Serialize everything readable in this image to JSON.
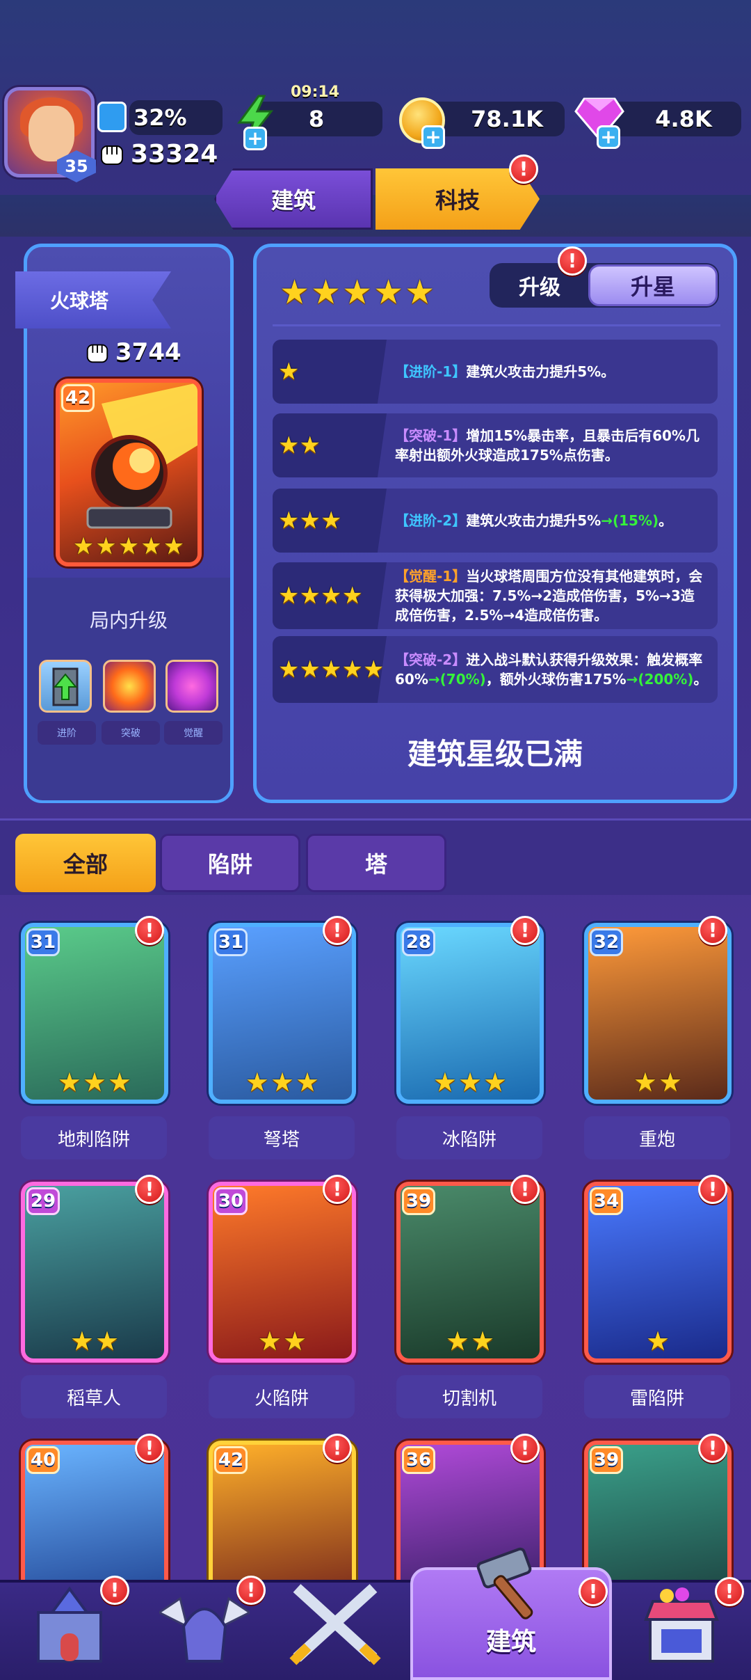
{
  "top": {
    "level": "35",
    "progress_percent": "32%",
    "progress_value": 0.32,
    "power": "33324",
    "timer": "09:14",
    "energy": "8",
    "gold": "78.1K",
    "gems": "4.8K"
  },
  "header": {
    "tab_build": "建筑",
    "tab_tech": "科技"
  },
  "building": {
    "name": "火球塔",
    "power": "3744",
    "level": "42",
    "stars": 5,
    "inner_upgrade_title": "局内升级",
    "skills": [
      {
        "label": "进阶"
      },
      {
        "label": "突破"
      },
      {
        "label": "觉醒"
      }
    ]
  },
  "panel": {
    "toggle_upgrade": "升级",
    "toggle_star": "升星",
    "rows": [
      {
        "stars": 1,
        "tag": "【进阶-1】",
        "tag_color": "blue",
        "text": "建筑火攻击力提升5%。"
      },
      {
        "stars": 2,
        "tag": "【突破-1】",
        "tag_color": "purple",
        "text": "增加15%暴击率，且暴击后有60%几率射出额外火球造成175%点伤害。"
      },
      {
        "stars": 3,
        "tag": "【进阶-2】",
        "tag_color": "blue",
        "text": "建筑火攻击力提升5%",
        "extra": "→(15%)",
        "tail": "。"
      },
      {
        "stars": 4,
        "tag": "【觉醒-1】",
        "tag_color": "orange",
        "text": "当火球塔周围方位没有其他建筑时，会获得极大加强：7.5%→2造成倍伤害，5%→3造成倍伤害，2.5%→4造成倍伤害。"
      },
      {
        "stars": 5,
        "tag": "【突破-2】",
        "tag_color": "purple",
        "text": "进入战斗默认获得升级效果：触发概率60%",
        "extra": "→(70%)",
        "text2": "，额外火球伤害175%",
        "extra2": "→(200%)",
        "tail": "。"
      }
    ],
    "maxed_text": "建筑星级已满"
  },
  "filters": {
    "all": "全部",
    "trap": "陷阱",
    "tower": "塔"
  },
  "cards": [
    {
      "level": "31",
      "name": "地刺陷阱",
      "stars": 3,
      "frame": "blue"
    },
    {
      "level": "31",
      "name": "弩塔",
      "stars": 3,
      "frame": "blue"
    },
    {
      "level": "28",
      "name": "冰陷阱",
      "stars": 3,
      "frame": "blue"
    },
    {
      "level": "32",
      "name": "重炮",
      "stars": 2,
      "frame": "blue"
    },
    {
      "level": "29",
      "name": "稻草人",
      "stars": 2,
      "frame": "pink"
    },
    {
      "level": "30",
      "name": "火陷阱",
      "stars": 2,
      "frame": "pink"
    },
    {
      "level": "39",
      "name": "切割机",
      "stars": 2,
      "frame": "red"
    },
    {
      "level": "34",
      "name": "雷陷阱",
      "stars": 1,
      "frame": "red"
    },
    {
      "level": "40",
      "name": "",
      "stars": 0,
      "frame": "red"
    },
    {
      "level": "42",
      "name": "",
      "stars": 0,
      "frame": "gold"
    },
    {
      "level": "36",
      "name": "",
      "stars": 0,
      "frame": "red"
    },
    {
      "level": "39",
      "name": "",
      "stars": 0,
      "frame": "red"
    }
  ],
  "nav": {
    "active_label": "建筑",
    "items": [
      "castle-icon",
      "helmet-icon",
      "swords-icon",
      "hammer-icon",
      "shop-icon"
    ]
  },
  "alert_symbol": "!",
  "plus_symbol": "+",
  "star_symbol": "★"
}
